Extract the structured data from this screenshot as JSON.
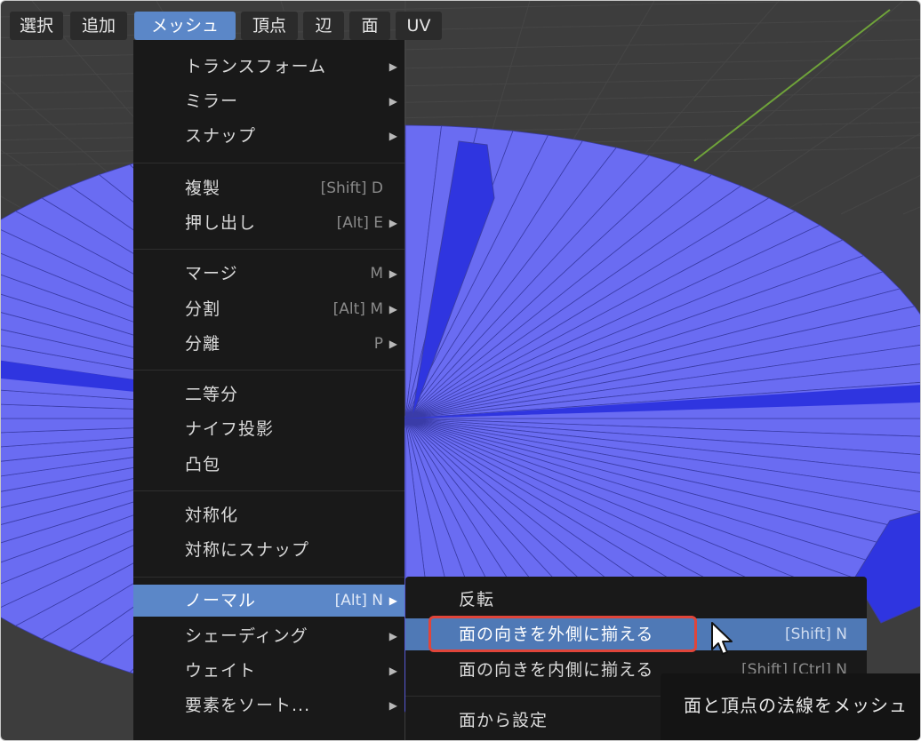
{
  "menubar": {
    "tabs": [
      "選択",
      "追加",
      "メッシュ",
      "頂点",
      "辺",
      "面",
      "UV"
    ],
    "active_tab": "メッシュ"
  },
  "mesh_menu": {
    "items": [
      {
        "label": "トランスフォーム",
        "shortcut": "",
        "submenu": true
      },
      {
        "label": "ミラー",
        "shortcut": "",
        "submenu": true
      },
      {
        "label": "スナップ",
        "shortcut": "",
        "submenu": true
      },
      {
        "label": "複製",
        "shortcut": "[Shift] D",
        "submenu": false
      },
      {
        "label": "押し出し",
        "shortcut": "[Alt] E",
        "submenu": true
      },
      {
        "label": "マージ",
        "shortcut": "M",
        "submenu": true
      },
      {
        "label": "分割",
        "shortcut": "[Alt] M",
        "submenu": true
      },
      {
        "label": "分離",
        "shortcut": "P",
        "submenu": true
      },
      {
        "label": "二等分",
        "shortcut": "",
        "submenu": false
      },
      {
        "label": "ナイフ投影",
        "shortcut": "",
        "submenu": false
      },
      {
        "label": "凸包",
        "shortcut": "",
        "submenu": false
      },
      {
        "label": "対称化",
        "shortcut": "",
        "submenu": false
      },
      {
        "label": "対称にスナップ",
        "shortcut": "",
        "submenu": false
      },
      {
        "label": "ノーマル",
        "shortcut": "[Alt] N",
        "submenu": true
      },
      {
        "label": "シェーディング",
        "shortcut": "",
        "submenu": true
      },
      {
        "label": "ウェイト",
        "shortcut": "",
        "submenu": true
      },
      {
        "label": "要素をソート...",
        "shortcut": "",
        "submenu": true
      }
    ],
    "active_item": "ノーマル"
  },
  "normals_submenu": {
    "items": [
      {
        "label": "反転",
        "shortcut": ""
      },
      {
        "label": "面の向きを外側に揃える",
        "shortcut": "[Shift] N"
      },
      {
        "label": "面の向きを内側に揃える",
        "shortcut": "[Shift] [Ctrl] N"
      },
      {
        "label": "面から設定",
        "shortcut": ""
      }
    ],
    "hovered_item": "面の向きを外側に揃える"
  },
  "tooltip": {
    "text": "面と頂点の法線をメッシュ"
  },
  "colors": {
    "viewport_bg": "#3d3d3d",
    "mesh_face": "#6a6cf2",
    "mesh_edge": "#3b3da8",
    "mesh_side": "#2f35e0",
    "menu_bg": "#191919",
    "menu_active": "#5b87c8",
    "highlight_box": "#e0453a",
    "axis_line": "#6fa33a"
  },
  "icons": {
    "pointer": "mouse-pointer-icon",
    "submenu_arrow": "triangle-right-icon"
  }
}
